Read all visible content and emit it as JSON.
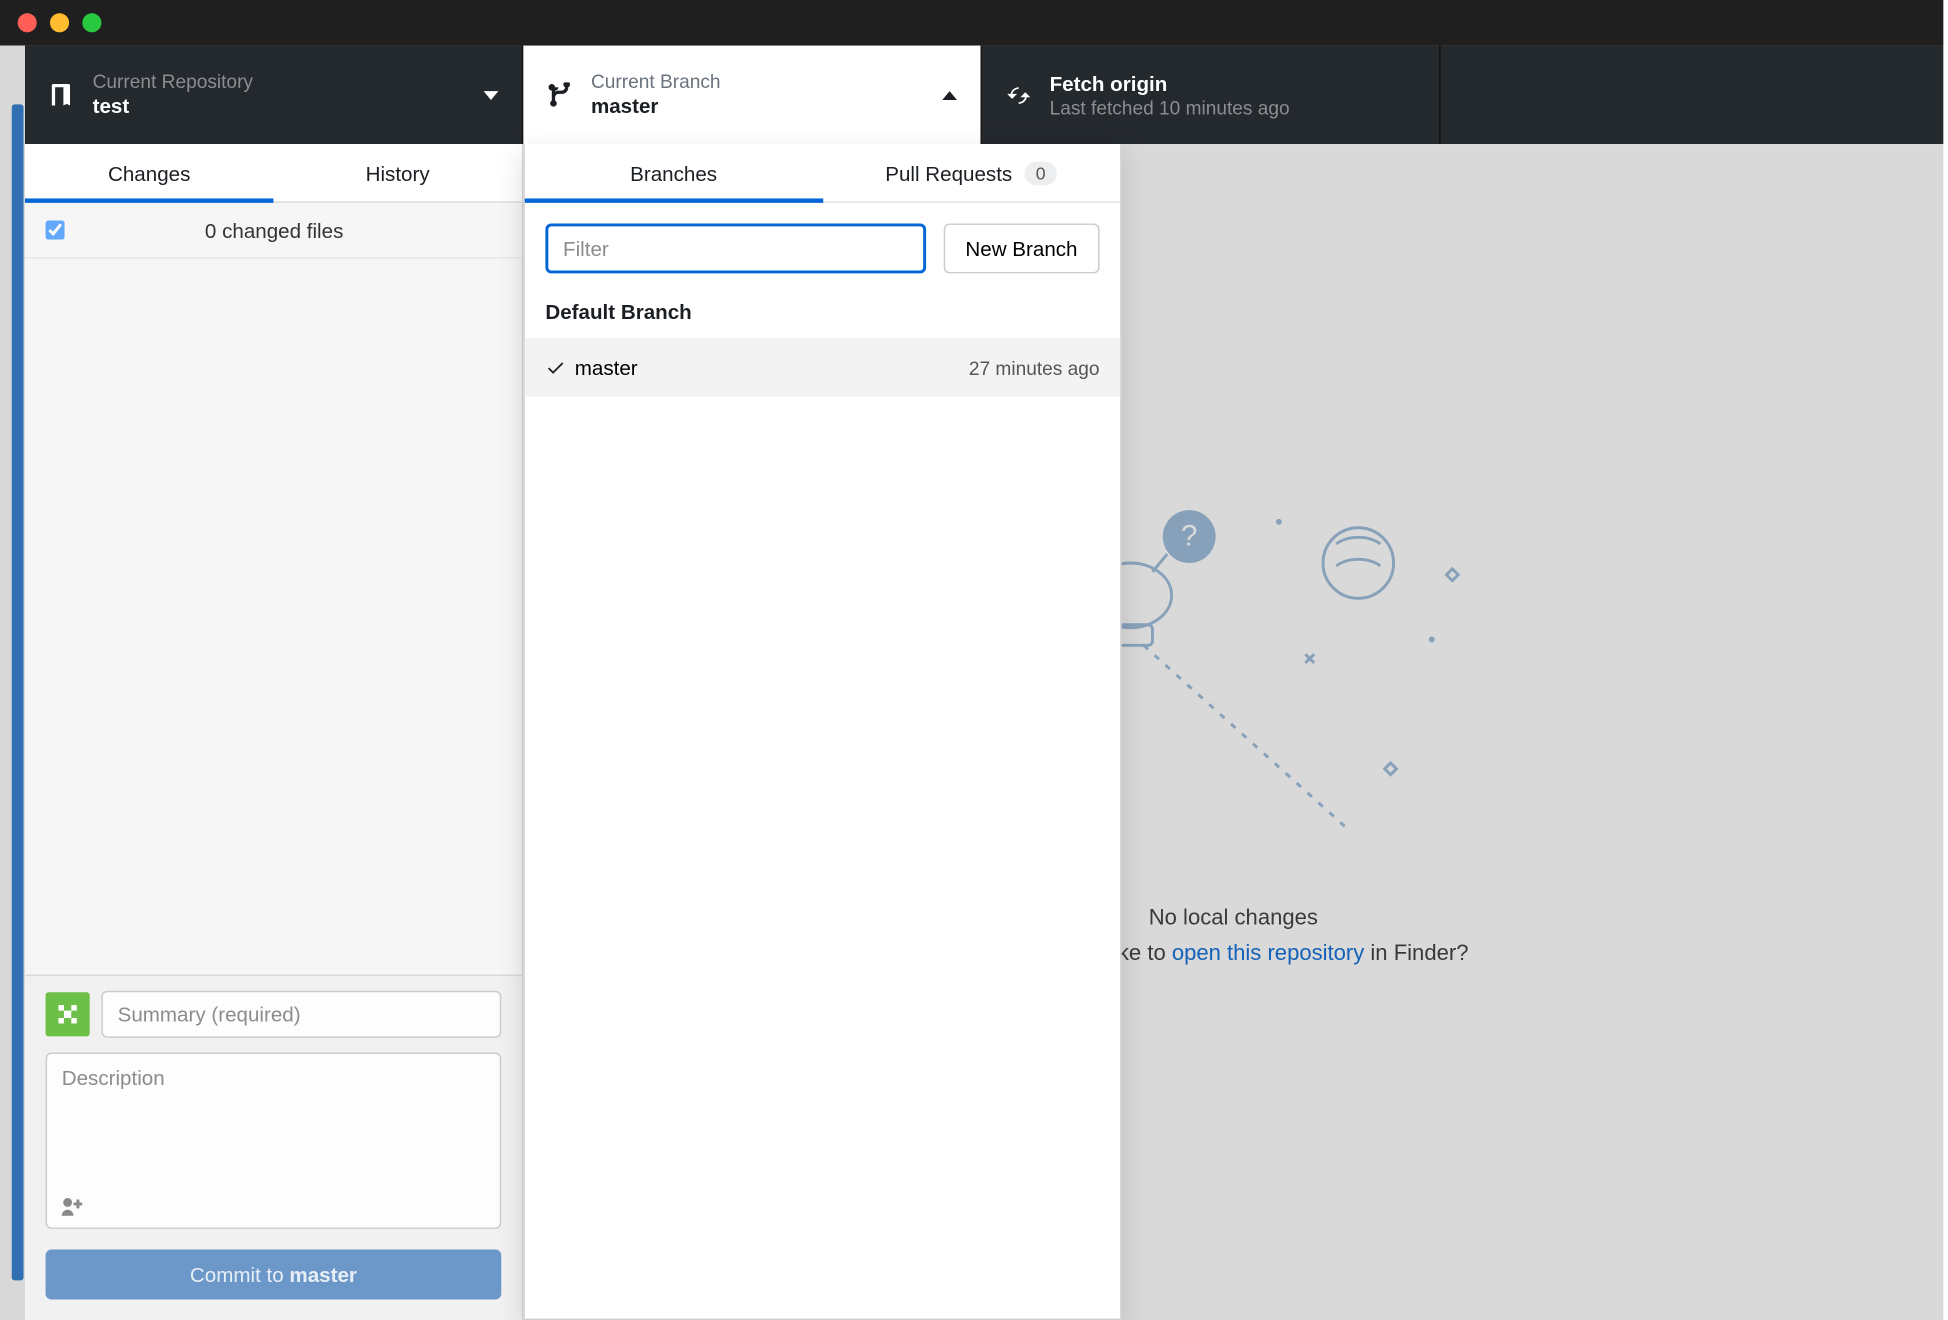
{
  "toolbar": {
    "repo": {
      "label": "Current Repository",
      "value": "test"
    },
    "branch": {
      "label": "Current Branch",
      "value": "master"
    },
    "fetch": {
      "label": "Fetch origin",
      "value": "Last fetched 10 minutes ago"
    }
  },
  "sidebar": {
    "tabs": {
      "changes": "Changes",
      "history": "History"
    },
    "changed_files_label": "0 changed files",
    "commit": {
      "summary_placeholder": "Summary (required)",
      "description_placeholder": "Description",
      "button_prefix": "Commit to ",
      "button_branch": "master"
    }
  },
  "main": {
    "title": "No local changes",
    "prompt_prefix": "Would you like to ",
    "prompt_link": "open this repository",
    "prompt_suffix": " in Finder?"
  },
  "branch_popup": {
    "tabs": {
      "branches": "Branches",
      "pull_requests": "Pull Requests",
      "pr_count": "0"
    },
    "filter_placeholder": "Filter",
    "new_branch_label": "New Branch",
    "section_label": "Default Branch",
    "items": [
      {
        "name": "master",
        "time": "27 minutes ago",
        "checked": true
      }
    ]
  }
}
